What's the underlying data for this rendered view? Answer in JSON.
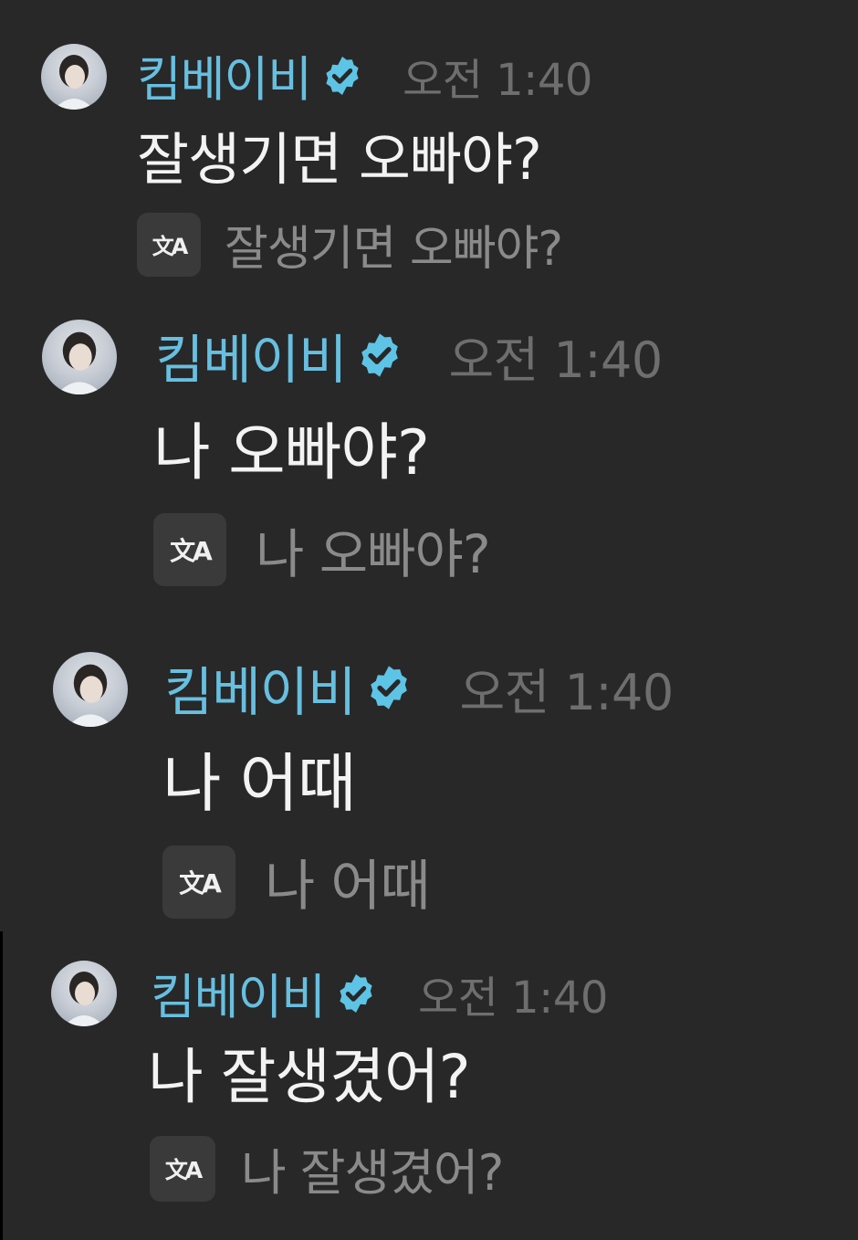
{
  "messages": [
    {
      "author": "킴베이비",
      "verified": true,
      "time": "오전 1:40",
      "text": "잘생기면 오빠야?",
      "translation": "잘생기면 오빠야?",
      "translate_icon": "translate-icon"
    },
    {
      "author": "킴베이비",
      "verified": true,
      "time": "오전 1:40",
      "text": "나 오빠야?",
      "translation": "나 오빠야?",
      "translate_icon": "translate-icon"
    },
    {
      "author": "킴베이비",
      "verified": true,
      "time": "오전 1:40",
      "text": "나 어때",
      "translation": "나 어때",
      "translate_icon": "translate-icon"
    },
    {
      "author": "킴베이비",
      "verified": true,
      "time": "오전 1:40",
      "text": "나 잘생겼어?",
      "translation": "나 잘생겼어?",
      "translate_icon": "translate-icon"
    }
  ],
  "colors": {
    "background": "#282828",
    "author_name": "#67bfe0",
    "verified_badge": "#5ec4e6",
    "timestamp": "#6e6e6e",
    "message_text": "#f3f3f3",
    "translation_text": "#8a8a8a"
  }
}
